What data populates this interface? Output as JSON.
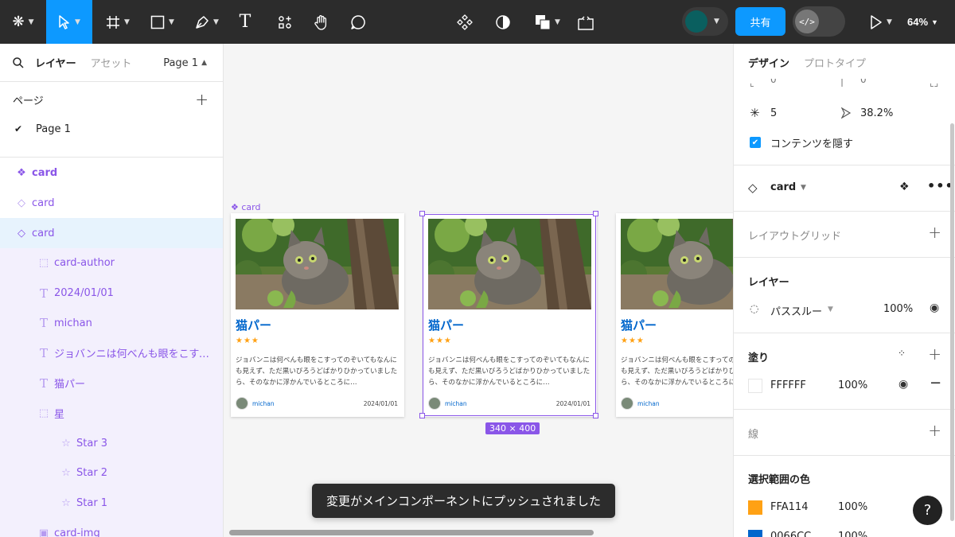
{
  "toolbar": {
    "logo_icon": "figma-menu-icon",
    "tools": [
      "move-tool-icon",
      "frame-tool-icon",
      "shape-tool-icon",
      "pen-tool-icon",
      "text-tool-icon",
      "resources-icon",
      "hand-tool-icon",
      "comment-tool-icon"
    ],
    "center": [
      "component-icon",
      "contrast-icon",
      "boolean-icon",
      "dev-mode-crop-icon"
    ],
    "text_tool_glyph": "T",
    "share_label": "共有",
    "dev_toggle_glyph": "</>",
    "zoom": "64%",
    "user_swatch_color": "#0a5f5f"
  },
  "left_panel": {
    "tab_layers": "レイヤー",
    "tab_assets": "アセット",
    "page_selector": "Page 1",
    "pages_heading": "ページ",
    "pages": [
      {
        "name": "Page 1",
        "active": true
      }
    ],
    "layers": [
      {
        "name": "card",
        "icon": "component-main-icon",
        "level": 0,
        "bold": true
      },
      {
        "name": "card",
        "icon": "instance-icon",
        "level": 0
      },
      {
        "name": "card",
        "icon": "instance-icon",
        "level": 0,
        "selected": true
      },
      {
        "name": "card-author",
        "icon": "frame-dashed-icon",
        "level": 1
      },
      {
        "name": "2024/01/01",
        "icon": "text-layer-icon",
        "level": 1
      },
      {
        "name": "michan",
        "icon": "text-layer-icon",
        "level": 1
      },
      {
        "name": "ジョバンニは何べんも眼をこすってのぞいてもなんにも見えず",
        "icon": "text-layer-icon",
        "level": 1
      },
      {
        "name": "猫パー",
        "icon": "text-layer-icon",
        "level": 1
      },
      {
        "name": "星",
        "icon": "frame-dashed-icon",
        "level": 1
      },
      {
        "name": "Star 3",
        "icon": "star-layer-icon",
        "level": 2
      },
      {
        "name": "Star 2",
        "icon": "star-layer-icon",
        "level": 2
      },
      {
        "name": "Star 1",
        "icon": "star-layer-icon",
        "level": 2
      },
      {
        "name": "card-img",
        "icon": "image-layer-icon",
        "level": 1
      }
    ]
  },
  "canvas": {
    "frame_label": "card",
    "size_badge": "340 × 400",
    "toast": "変更がメインコンポーネントにプッシュされました",
    "card": {
      "title": "猫パー",
      "stars": "★★★",
      "rating": 3,
      "body": "ジョバンニは何べんも眼をこすってのぞいてもなんにも見えず、ただ黒いびろうどばかりひかっていましたら、そのなかに浮かんでいるところに…",
      "author": "michan",
      "date": "2024/01/01"
    }
  },
  "right_panel": {
    "tab_design": "デザイン",
    "tab_prototype": "プロトタイプ",
    "cut_values": [
      "0",
      "0"
    ],
    "point_count": "5",
    "ratio": "38.2%",
    "hide_content_label": "コンテンツを隠す",
    "component_name": "card",
    "layout_grid": "レイアウトグリッド",
    "layer_heading": "レイヤー",
    "blend_mode": "パススルー",
    "layer_opacity": "100%",
    "fill_heading": "塗り",
    "fill_hex": "FFFFFF",
    "fill_opacity": "100%",
    "stroke_heading": "線",
    "selection_colors_heading": "選択範囲の色",
    "selection_colors": [
      {
        "hex": "FFA114",
        "opacity": "100%",
        "color": "#ffa114"
      },
      {
        "hex": "0066CC",
        "opacity": "100%",
        "color": "#0066cc"
      }
    ],
    "help": "?"
  },
  "colors": {
    "accent": "#0d99ff",
    "component": "#8a56e8",
    "title_blue": "#0066cc",
    "star_orange": "#ffa114"
  }
}
